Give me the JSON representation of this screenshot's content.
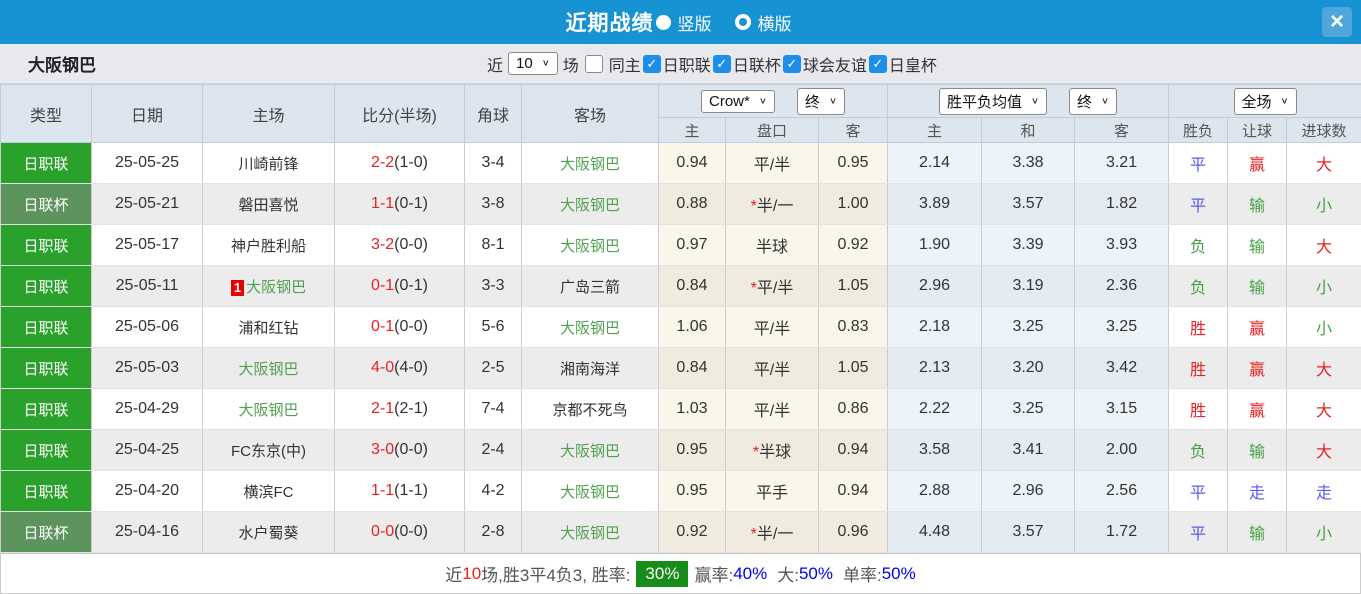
{
  "title_bar": {
    "title": "近期战绩",
    "view_vertical_label": "竖版",
    "view_horizontal_label": "横版",
    "close_glyph": "×"
  },
  "filter": {
    "team": "大阪钢巴",
    "near_label": "近",
    "matches_value": "10",
    "matches_label": "场",
    "same_home": {
      "label": "同主",
      "checked": false
    },
    "leagues": [
      {
        "label": "日职联",
        "checked": true
      },
      {
        "label": "日联杯",
        "checked": true
      },
      {
        "label": "球会友谊",
        "checked": true
      },
      {
        "label": "日皇杯",
        "checked": true
      }
    ],
    "check_glyph": "✓"
  },
  "table": {
    "columns": {
      "type": "类型",
      "date": "日期",
      "home": "主场",
      "score": "比分(半场)",
      "corner": "角球",
      "away": "客场",
      "odds_home": "主",
      "odds_line": "盘口",
      "odds_away": "客",
      "avg_home": "主",
      "avg_draw": "和",
      "avg_away": "客",
      "wdl": "胜负",
      "handicap": "让球",
      "goals": "进球数"
    },
    "dropdowns": {
      "bookmaker": "Crow*",
      "bookmaker_time": "终",
      "avg_type": "胜平负均值",
      "avg_time": "终",
      "scope": "全场"
    },
    "rows": [
      {
        "type": "日职联",
        "date": "25-05-25",
        "home": "川崎前锋",
        "home_badge": null,
        "score_ft": "2-2",
        "score_ht": "(1-0)",
        "corner": "3-4",
        "away": "大阪钢巴",
        "odds_home": "0.94",
        "line_star": "",
        "line": "平/半",
        "odds_away": "0.95",
        "avg_home": "2.14",
        "avg_draw": "3.38",
        "avg_away": "3.21",
        "wdl": "平",
        "handicap_result": "赢",
        "goals_result": "大"
      },
      {
        "type": "日联杯",
        "date": "25-05-21",
        "home": "磐田喜悦",
        "home_badge": null,
        "score_ft": "1-1",
        "score_ht": "(0-1)",
        "corner": "3-8",
        "away": "大阪钢巴",
        "odds_home": "0.88",
        "line_star": "*",
        "line": "半/一",
        "odds_away": "1.00",
        "avg_home": "3.89",
        "avg_draw": "3.57",
        "avg_away": "1.82",
        "wdl": "平",
        "handicap_result": "输",
        "goals_result": "小"
      },
      {
        "type": "日职联",
        "date": "25-05-17",
        "home": "神户胜利船",
        "home_badge": null,
        "score_ft": "3-2",
        "score_ht": "(0-0)",
        "corner": "8-1",
        "away": "大阪钢巴",
        "odds_home": "0.97",
        "line_star": "",
        "line": "半球",
        "odds_away": "0.92",
        "avg_home": "1.90",
        "avg_draw": "3.39",
        "avg_away": "3.93",
        "wdl": "负",
        "handicap_result": "输",
        "goals_result": "大"
      },
      {
        "type": "日职联",
        "date": "25-05-11",
        "home": "大阪钢巴",
        "home_badge": "1",
        "score_ft": "0-1",
        "score_ht": "(0-1)",
        "corner": "3-3",
        "away": "广岛三箭",
        "odds_home": "0.84",
        "line_star": "*",
        "line": "平/半",
        "odds_away": "1.05",
        "avg_home": "2.96",
        "avg_draw": "3.19",
        "avg_away": "2.36",
        "wdl": "负",
        "handicap_result": "输",
        "goals_result": "小"
      },
      {
        "type": "日职联",
        "date": "25-05-06",
        "home": "浦和红钻",
        "home_badge": null,
        "score_ft": "0-1",
        "score_ht": "(0-0)",
        "corner": "5-6",
        "away": "大阪钢巴",
        "odds_home": "1.06",
        "line_star": "",
        "line": "平/半",
        "odds_away": "0.83",
        "avg_home": "2.18",
        "avg_draw": "3.25",
        "avg_away": "3.25",
        "wdl": "胜",
        "handicap_result": "赢",
        "goals_result": "小"
      },
      {
        "type": "日职联",
        "date": "25-05-03",
        "home": "大阪钢巴",
        "home_badge": null,
        "score_ft": "4-0",
        "score_ht": "(4-0)",
        "corner": "2-5",
        "away": "湘南海洋",
        "odds_home": "0.84",
        "line_star": "",
        "line": "平/半",
        "odds_away": "1.05",
        "avg_home": "2.13",
        "avg_draw": "3.20",
        "avg_away": "3.42",
        "wdl": "胜",
        "handicap_result": "赢",
        "goals_result": "大"
      },
      {
        "type": "日职联",
        "date": "25-04-29",
        "home": "大阪钢巴",
        "home_badge": null,
        "score_ft": "2-1",
        "score_ht": "(2-1)",
        "corner": "7-4",
        "away": "京都不死鸟",
        "odds_home": "1.03",
        "line_star": "",
        "line": "平/半",
        "odds_away": "0.86",
        "avg_home": "2.22",
        "avg_draw": "3.25",
        "avg_away": "3.15",
        "wdl": "胜",
        "handicap_result": "赢",
        "goals_result": "大"
      },
      {
        "type": "日职联",
        "date": "25-04-25",
        "home": "FC东京(中)",
        "home_badge": null,
        "score_ft": "3-0",
        "score_ht": "(0-0)",
        "corner": "2-4",
        "away": "大阪钢巴",
        "odds_home": "0.95",
        "line_star": "*",
        "line": "半球",
        "odds_away": "0.94",
        "avg_home": "3.58",
        "avg_draw": "3.41",
        "avg_away": "2.00",
        "wdl": "负",
        "handicap_result": "输",
        "goals_result": "大"
      },
      {
        "type": "日职联",
        "date": "25-04-20",
        "home": "横滨FC",
        "home_badge": null,
        "score_ft": "1-1",
        "score_ht": "(1-1)",
        "corner": "4-2",
        "away": "大阪钢巴",
        "odds_home": "0.95",
        "line_star": "",
        "line": "平手",
        "odds_away": "0.94",
        "avg_home": "2.88",
        "avg_draw": "2.96",
        "avg_away": "2.56",
        "wdl": "平",
        "handicap_result": "走",
        "goals_result": "走"
      },
      {
        "type": "日联杯",
        "date": "25-04-16",
        "home": "水户蜀葵",
        "home_badge": null,
        "score_ft": "0-0",
        "score_ht": "(0-0)",
        "corner": "2-8",
        "away": "大阪钢巴",
        "odds_home": "0.92",
        "line_star": "*",
        "line": "半/一",
        "odds_away": "0.96",
        "avg_home": "4.48",
        "avg_draw": "3.57",
        "avg_away": "1.72",
        "wdl": "平",
        "handicap_result": "输",
        "goals_result": "小"
      }
    ]
  },
  "style_maps": {
    "type_class": {
      "日职联": "type-j1",
      "日联杯": "type-cup"
    },
    "result_class": {
      "胜": "c-red",
      "赢": "c-red",
      "大": "c-red",
      "负": "c-green",
      "输": "c-green",
      "小": "c-green",
      "平": "c-blue",
      "走": "c-blue"
    }
  },
  "summary": {
    "near_label": "近",
    "count": "10",
    "middle": "场,胜3平4负3, 胜率:",
    "win_rate": "30%",
    "seg2_label": "赢率:",
    "seg2_value": "40%",
    "seg3_label": "大:",
    "seg3_value": "50%",
    "seg4_label": "单率:",
    "seg4_value": "50%"
  },
  "colors": {
    "titlebar_blue": "#1792d2",
    "checkbox_blue": "#1e8fe8",
    "league_green": "#2aa12a",
    "cup_green": "#5d935d",
    "focus_team_green": "#52a052",
    "score_red": "#e62222",
    "result_blue": "#5a5aee",
    "result_green": "#44a044",
    "win_badge_green": "#188c18",
    "summary_value_blue": "#0000e6"
  }
}
